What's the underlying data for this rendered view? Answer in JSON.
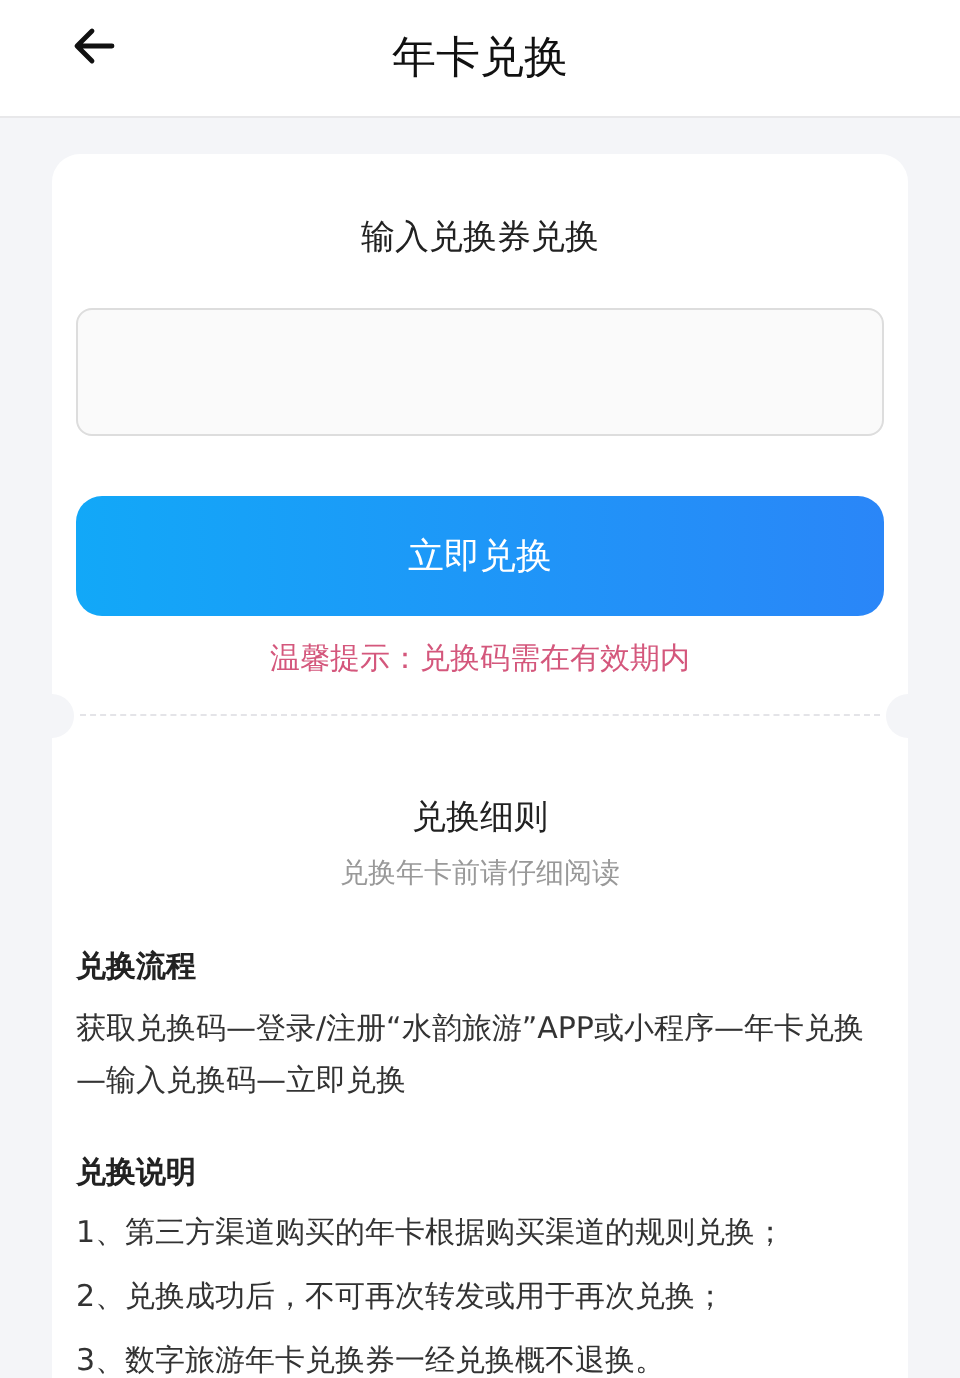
{
  "header": {
    "title": "年卡兑换"
  },
  "redeem": {
    "heading": "输入兑换券兑换",
    "button": "立即兑换",
    "tip": "温馨提示：兑换码需在有效期内"
  },
  "rules": {
    "title": "兑换细则",
    "subtitle": "兑换年卡前请仔细阅读",
    "sections": [
      {
        "heading": "兑换流程",
        "kind": "paragraph",
        "lines": [
          "获取兑换码—登录/注册“水韵旅游”APP或小程序—年卡兑换—输入兑换码—立即兑换"
        ]
      },
      {
        "heading": "兑换说明",
        "kind": "list",
        "lines": [
          "1、第三方渠道购买的年卡根据购买渠道的规则兑换；",
          "2、兑换成功后，不可再次转发或用于再次兑换；",
          "3、数字旅游年卡兑换券一经兑换概不退换。"
        ]
      }
    ]
  }
}
